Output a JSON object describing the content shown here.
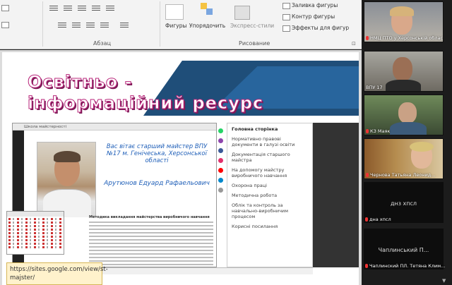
{
  "ribbon": {
    "paragraph_label": "Абзац",
    "drawing_label": "Рисование",
    "shapes_label": "Фигуры",
    "arrange_label": "Упорядочить",
    "quick_styles_label": "Экспресс-стили",
    "fill_label": "Заливка фигуры",
    "outline_label": "Контур фигуры",
    "effects_label": "Эффекты для фигур"
  },
  "slide": {
    "title_line1": "Освітньо -",
    "title_line2": "інформаційний ресурс",
    "web": {
      "tab_title": "Школа майстерності",
      "welcome": "Вас вітає старший майстер ВПУ №17 м. Генічеська, Херсонської області",
      "name": "Арутюнов Едуард Рафаельович",
      "article_heading": "Методика викладання майстерства виробничого навчання"
    },
    "menu": [
      "Головна сторінка",
      "Нормативно правові документи в галузі освіти",
      "Документація старшого майстра",
      "На допомогу майстру виробничого навчання",
      "Охорона праці",
      "Методична робота",
      "Облік та контроль за навчально-виробничим процесом",
      "Корисні посилання"
    ],
    "url_box": "https://sites.google.com/view/st-majster/"
  },
  "participants": [
    {
      "label": "НМЦ ПТО у Херсонській області",
      "mic": "muted"
    },
    {
      "label": "ВПУ 17",
      "mic": "on"
    },
    {
      "label": "КЗ Маяк",
      "mic": "muted"
    },
    {
      "label": "Чернова Татьяна Леонид...",
      "mic": "muted"
    },
    {
      "label": "дна хпсл",
      "mic": "muted",
      "center": "днз хпсл"
    },
    {
      "label": "Чаплинский ПЛ. Тетяна Клим...",
      "mic": "muted",
      "center": "Чаплинський П..."
    }
  ],
  "colors": {
    "title_band": "#1f4e79",
    "title_stroke": "#b8257a",
    "link_blue": "#1f5fb8",
    "url_bg": "#fff2cc"
  }
}
